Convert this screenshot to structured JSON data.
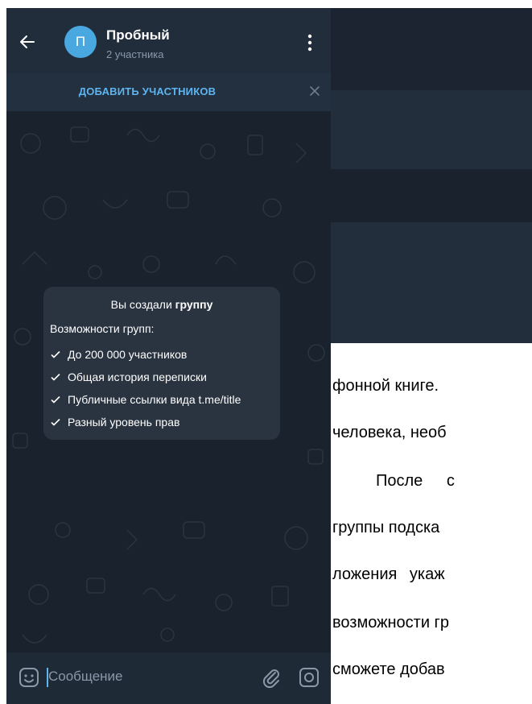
{
  "header": {
    "title": "Пробный",
    "subtitle": "2 участника",
    "avatar_letter": "П"
  },
  "add_bar": {
    "label": "ДОБАВИТЬ УЧАСТНИКОВ"
  },
  "info_card": {
    "title_prefix": "Вы создали ",
    "title_bold": "группу",
    "subtitle": "Возможности групп:",
    "features": [
      "До 200 000 участников",
      "Общая история переписки",
      "Публичные ссылки вида t.me/title",
      "Разный уровень прав"
    ]
  },
  "composer": {
    "placeholder": "Сообщение"
  },
  "document": {
    "lines": [
      "фонной книге.",
      "человека, необ",
      "После с",
      "группы подска",
      "ложения укаж",
      "возможности гр",
      "сможете добав"
    ]
  },
  "colors": {
    "background": "#1b2430",
    "header": "#212d3b",
    "accent": "#5fb5f0",
    "avatar": "#4aa8e0",
    "card": "#2a3441"
  }
}
